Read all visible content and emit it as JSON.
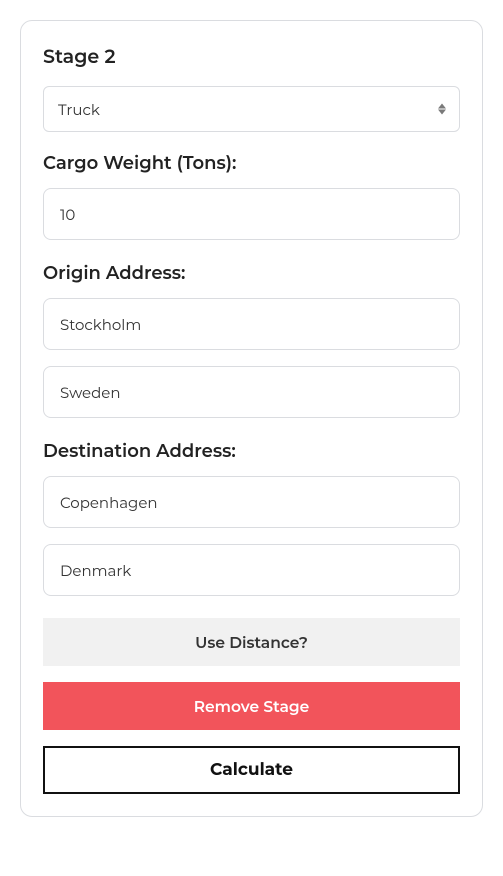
{
  "stage": {
    "title": "Stage 2",
    "transport_selected": "Truck"
  },
  "cargo_weight": {
    "label": "Cargo Weight (Tons):",
    "value": "10"
  },
  "origin": {
    "label": "Origin Address:",
    "city": "Stockholm",
    "country": "Sweden"
  },
  "destination": {
    "label": "Destination Address:",
    "city": "Copenhagen",
    "country": "Denmark"
  },
  "buttons": {
    "toggle_distance": "Use Distance?",
    "remove_stage": "Remove Stage",
    "calculate": "Calculate"
  }
}
